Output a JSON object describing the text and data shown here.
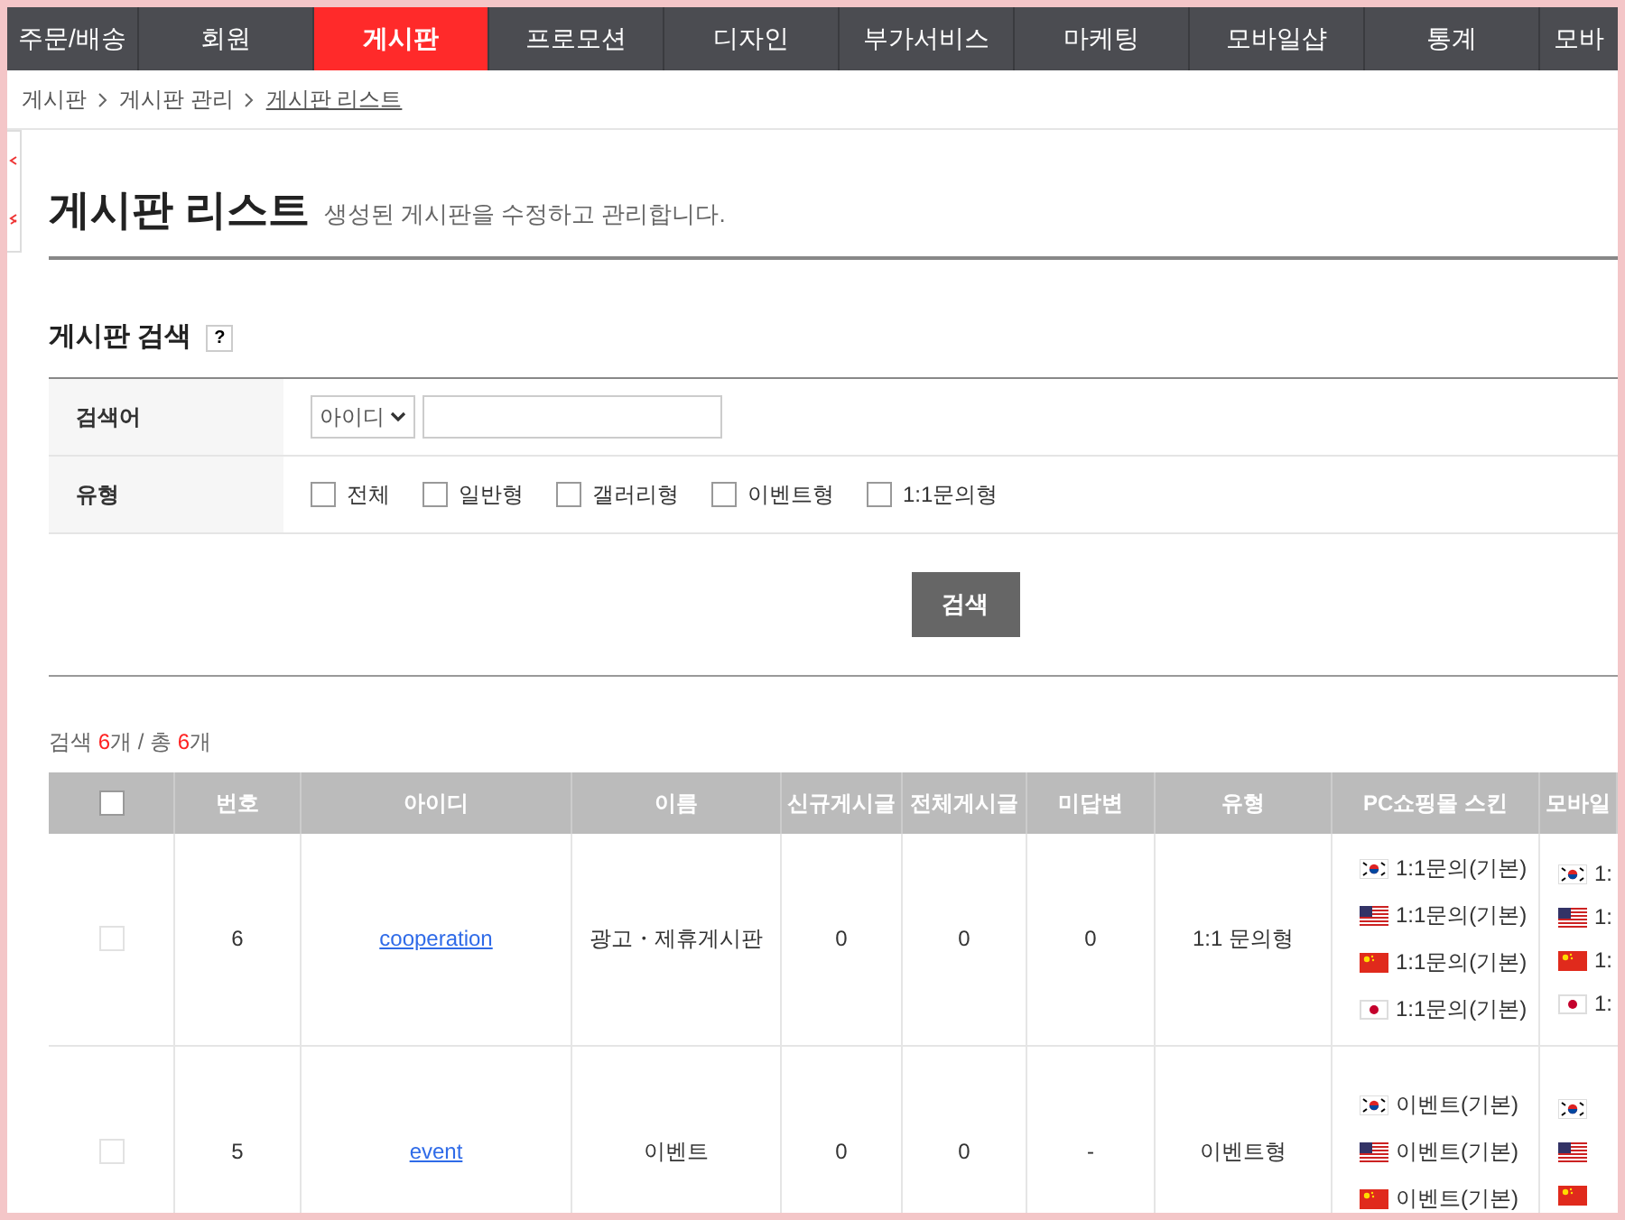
{
  "nav": [
    {
      "label": "주문/배송",
      "selected": false
    },
    {
      "label": "회원",
      "selected": false
    },
    {
      "label": "게시판",
      "selected": true
    },
    {
      "label": "프로모션",
      "selected": false
    },
    {
      "label": "디자인",
      "selected": false
    },
    {
      "label": "부가서비스",
      "selected": false
    },
    {
      "label": "마케팅",
      "selected": false
    },
    {
      "label": "모바일샵",
      "selected": false
    },
    {
      "label": "통계",
      "selected": false
    },
    {
      "label": "모바",
      "selected": false
    }
  ],
  "breadcrumb": [
    "게시판",
    "게시판 관리",
    "게시판 리스트"
  ],
  "page": {
    "title": "게시판 리스트",
    "subtitle": "생성된 게시판을 수정하고 관리합니다."
  },
  "search": {
    "title": "게시판 검색",
    "help": "?",
    "keyword_label": "검색어",
    "keyword_select": "아이디",
    "type_label": "유형",
    "types": [
      {
        "label": "전체",
        "checked": false
      },
      {
        "label": "일반형",
        "checked": false
      },
      {
        "label": "갤러리형",
        "checked": false
      },
      {
        "label": "이벤트형",
        "checked": false
      },
      {
        "label": "1:1문의형",
        "checked": false
      }
    ],
    "button": "검색"
  },
  "count": {
    "label1": "검색",
    "found": "6",
    "unit1": "개",
    "sep": "/",
    "label2": "총",
    "total": "6",
    "unit2": "개"
  },
  "table": {
    "select_all_checked": false,
    "columns": [
      "번호",
      "아이디",
      "이름",
      "신규게시글",
      "전체게시글",
      "미답변",
      "유형",
      "PC쇼핑몰 스킨",
      "모바일"
    ],
    "rows": [
      {
        "checked": false,
        "no": "6",
        "id": "cooperation",
        "name": "광고・제휴게시판",
        "new": "0",
        "total": "0",
        "unanswered": "0",
        "type": "1:1 문의형",
        "pc_skins": [
          {
            "kind": "kr",
            "text": "1:1문의(기본)"
          },
          {
            "kind": "us",
            "text": "1:1문의(기본)"
          },
          {
            "kind": "cn",
            "text": "1:1문의(기본)"
          },
          {
            "kind": "jp",
            "text": "1:1문의(기본)"
          }
        ],
        "mobile_skins": [
          {
            "kind": "kr",
            "text": "1:"
          },
          {
            "kind": "us",
            "text": "1:"
          },
          {
            "kind": "cn",
            "text": "1:"
          },
          {
            "kind": "jp",
            "text": "1:"
          }
        ]
      },
      {
        "checked": false,
        "no": "5",
        "id": "event",
        "name": "이벤트",
        "new": "0",
        "total": "0",
        "unanswered": "-",
        "type": "이벤트형",
        "pc_skins": [
          {
            "kind": "kr",
            "text": "이벤트(기본)"
          },
          {
            "kind": "us",
            "text": "이벤트(기본)"
          },
          {
            "kind": "cn",
            "text": "이벤트(기본)"
          }
        ],
        "mobile_skins": [
          {
            "kind": "kr"
          },
          {
            "kind": "us"
          },
          {
            "kind": "cn"
          }
        ]
      }
    ]
  }
}
